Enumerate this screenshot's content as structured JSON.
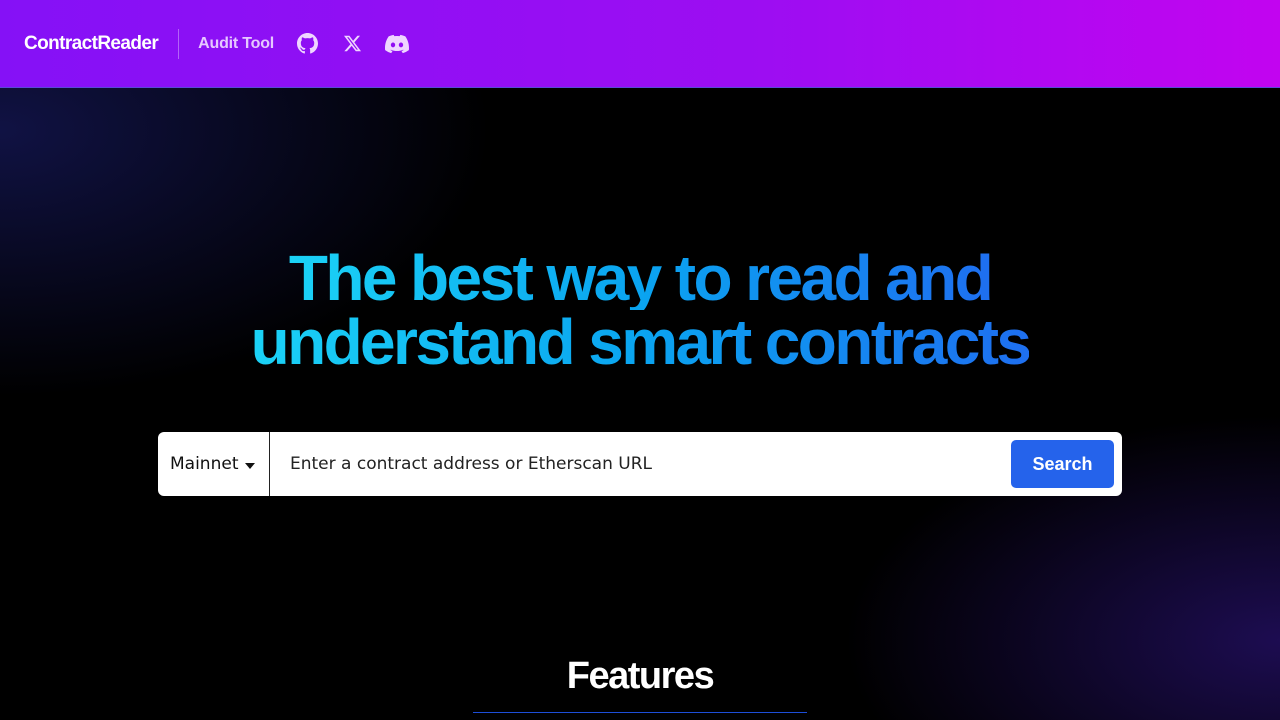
{
  "nav": {
    "brand": "ContractReader",
    "audit_link": "Audit Tool",
    "icons": [
      "github-icon",
      "x-icon",
      "discord-icon"
    ]
  },
  "hero": {
    "title_line1": "The best way to read and",
    "title_line2": "understand smart contracts"
  },
  "search": {
    "network": "Mainnet",
    "placeholder": "Enter a contract address or Etherscan URL",
    "value": "",
    "button_label": "Search"
  },
  "features": {
    "heading": "Features"
  },
  "colors": {
    "nav_gradient_start": "#8511f6",
    "nav_gradient_end": "#c204f0",
    "title_gradient_start": "#1bd2f6",
    "title_gradient_end": "#1e6ff0",
    "search_button": "#2563eb"
  }
}
